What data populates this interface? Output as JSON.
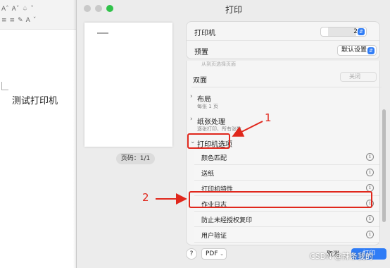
{
  "doc": {
    "toolbar_row1": [
      "Aˆ",
      "Aˇ",
      "♤",
      "ˇ"
    ],
    "toolbar_row2": [
      "≡",
      "≡",
      "✎",
      "A",
      "ˇ"
    ],
    "text": "测试打印机"
  },
  "dialog": {
    "title": "打印",
    "page_indicator": "页码：1/1",
    "printer_label": "打印机",
    "printer_count": "2",
    "preset_label": "预置",
    "preset_value": "默认设置",
    "faded_text": "从到页选择页面",
    "duplex_label": "双面",
    "duplex_value": "关闭",
    "layout_title": "布局",
    "layout_sub": "每张 1 页",
    "paper_title": "纸张处理",
    "paper_sub": "逐张打印、所有张数",
    "printer_options_title": "打印机选项",
    "options": [
      "颜色匹配",
      "送纸",
      "打印机特性",
      "作业日志",
      "防止未经授权复印",
      "用户验证"
    ],
    "help": "?",
    "pdf": "PDF",
    "cancel": "取消",
    "print": "打印"
  },
  "annotations": {
    "one": "1",
    "two": "2"
  },
  "watermark": "CSDN @辣条我的"
}
